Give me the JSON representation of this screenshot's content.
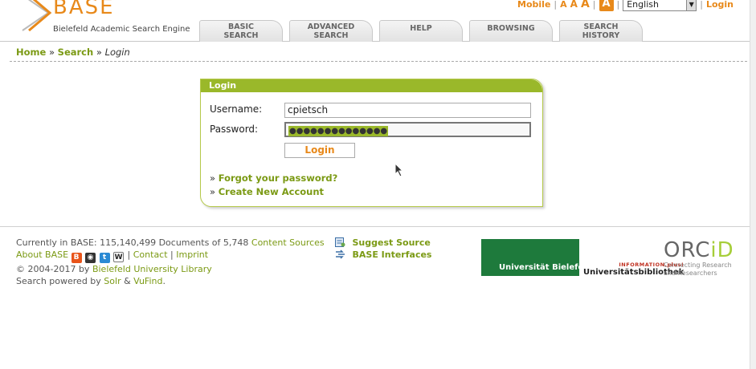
{
  "brand": {
    "name": "BASE",
    "subtitle": "Bielefeld Academic Search Engine",
    "accent": "#e8891a",
    "green": "#9ab82a"
  },
  "topbar": {
    "mobile": "Mobile",
    "font_small": "A",
    "font_medium": "A",
    "font_large": "A",
    "font_box": "A",
    "language": "English",
    "login": "Login"
  },
  "tabs": [
    {
      "line1": "BASIC",
      "line2": "SEARCH"
    },
    {
      "line1": "ADVANCED",
      "line2": "SEARCH"
    },
    {
      "line1": "HELP",
      "line2": ""
    },
    {
      "line1": "BROWSING",
      "line2": ""
    },
    {
      "line1": "SEARCH",
      "line2": "HISTORY"
    }
  ],
  "breadcrumb": {
    "home": "Home",
    "sep": "»",
    "search": "Search",
    "current": "Login"
  },
  "login": {
    "title": "Login",
    "username_label": "Username:",
    "username_value": "cpietsch",
    "password_label": "Password:",
    "password_value": "●●●●●●●●●●●●●●",
    "button": "Login",
    "bullet": "»",
    "forgot": "Forgot your password?",
    "create": "Create New Account"
  },
  "footer": {
    "currently_prefix": "Currently in BASE: 115,140,499 Documents of 5,748",
    "content_sources": "Content Sources",
    "about": "About BASE",
    "pipe": "|",
    "contact": "Contact",
    "imprint": "Imprint",
    "copyright_prefix": "© 2004-2017 by",
    "library": "Bielefeld University Library",
    "powered_prefix": "Search powered by",
    "solr": "Solr",
    "amp": "&",
    "vufind": "VuFind",
    "period": ".",
    "suggest": "Suggest Source",
    "interfaces": "BASE Interfaces",
    "uni_bielefeld": "Universität Bielefeld",
    "info_plus": "INFORMATION.plus!",
    "ub": "Universitätsbibliothek",
    "orcid_a": "ORC",
    "orcid_b": "iD",
    "orcid_tag1": "Connecting Research",
    "orcid_tag2": "and Researchers"
  }
}
